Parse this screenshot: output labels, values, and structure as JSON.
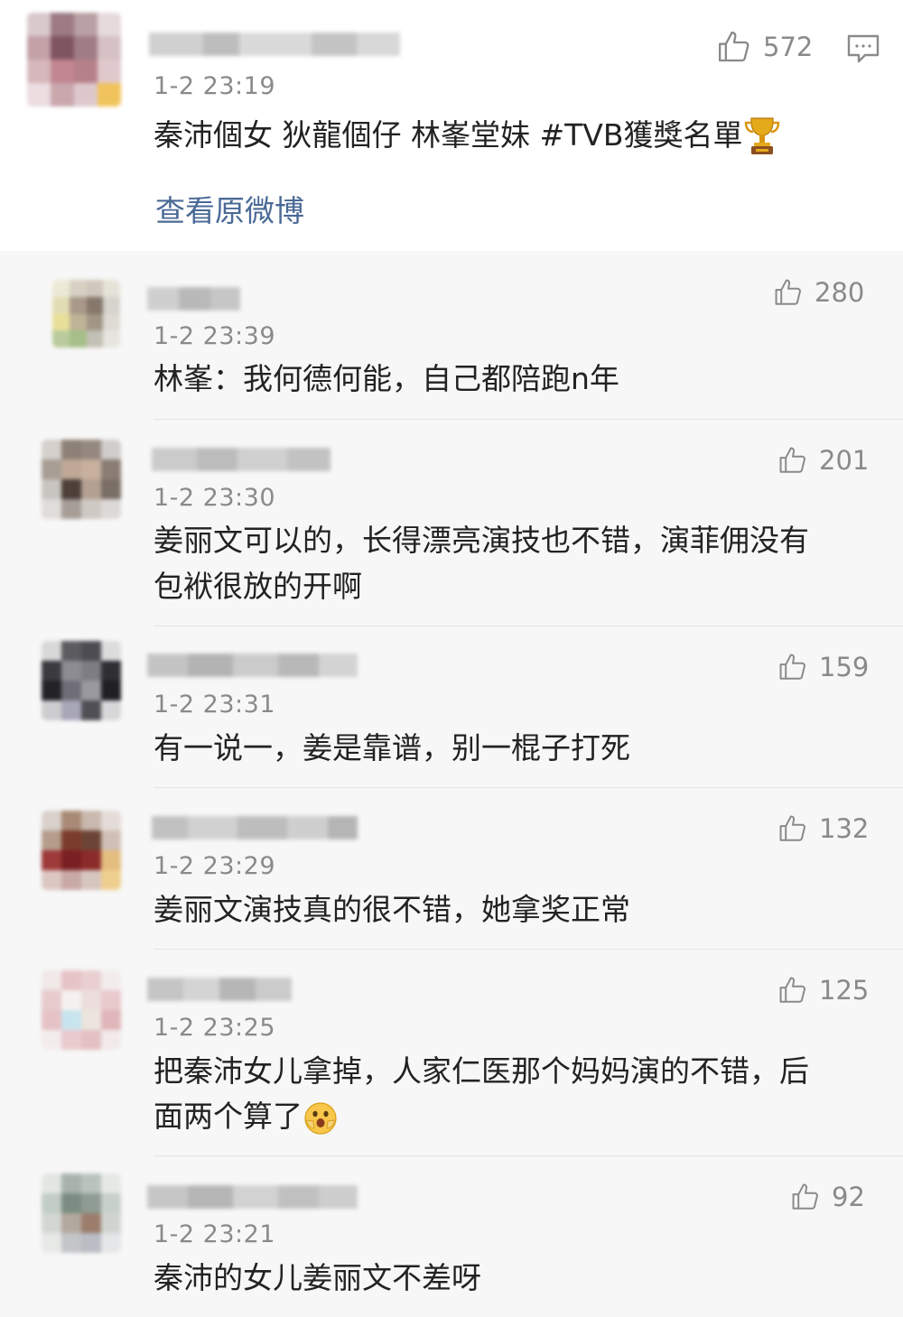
{
  "post": {
    "time": "1-2 23:19",
    "likes": "572",
    "text": "秦沛個女 狄龍個仔 林峯堂妹 #TVB獲獎名單",
    "trophy_icon": "trophy-icon",
    "view_original": "查看原微博"
  },
  "replies": [
    {
      "time": "1-2 23:39",
      "likes": "280",
      "lines": [
        "林峯：我何德何能，自己都陪跑n年"
      ]
    },
    {
      "time": "1-2 23:30",
      "likes": "201",
      "lines": [
        "姜丽文可以的，长得漂亮演技也不错，演菲佣没有",
        "包袱很放的开啊"
      ]
    },
    {
      "time": "1-2 23:31",
      "likes": "159",
      "lines": [
        "有一说一，姜是靠谱，别一棍子打死"
      ]
    },
    {
      "time": "1-2 23:29",
      "likes": "132",
      "lines": [
        "姜丽文演技真的很不错，她拿奖正常"
      ]
    },
    {
      "time": "1-2 23:25",
      "likes": "125",
      "lines": [
        "把秦沛女儿拿掉，人家仁医那个妈妈演的不错，后",
        "面两个算了"
      ]
    },
    {
      "time": "1-2 23:21",
      "likes": "92",
      "lines": [
        "秦沛的女儿姜丽文不差呀"
      ]
    }
  ],
  "colors": {
    "link": "#4a6a96",
    "meta": "#8a8a8a",
    "text": "#222222",
    "bg_reply": "#f7f7f7"
  }
}
